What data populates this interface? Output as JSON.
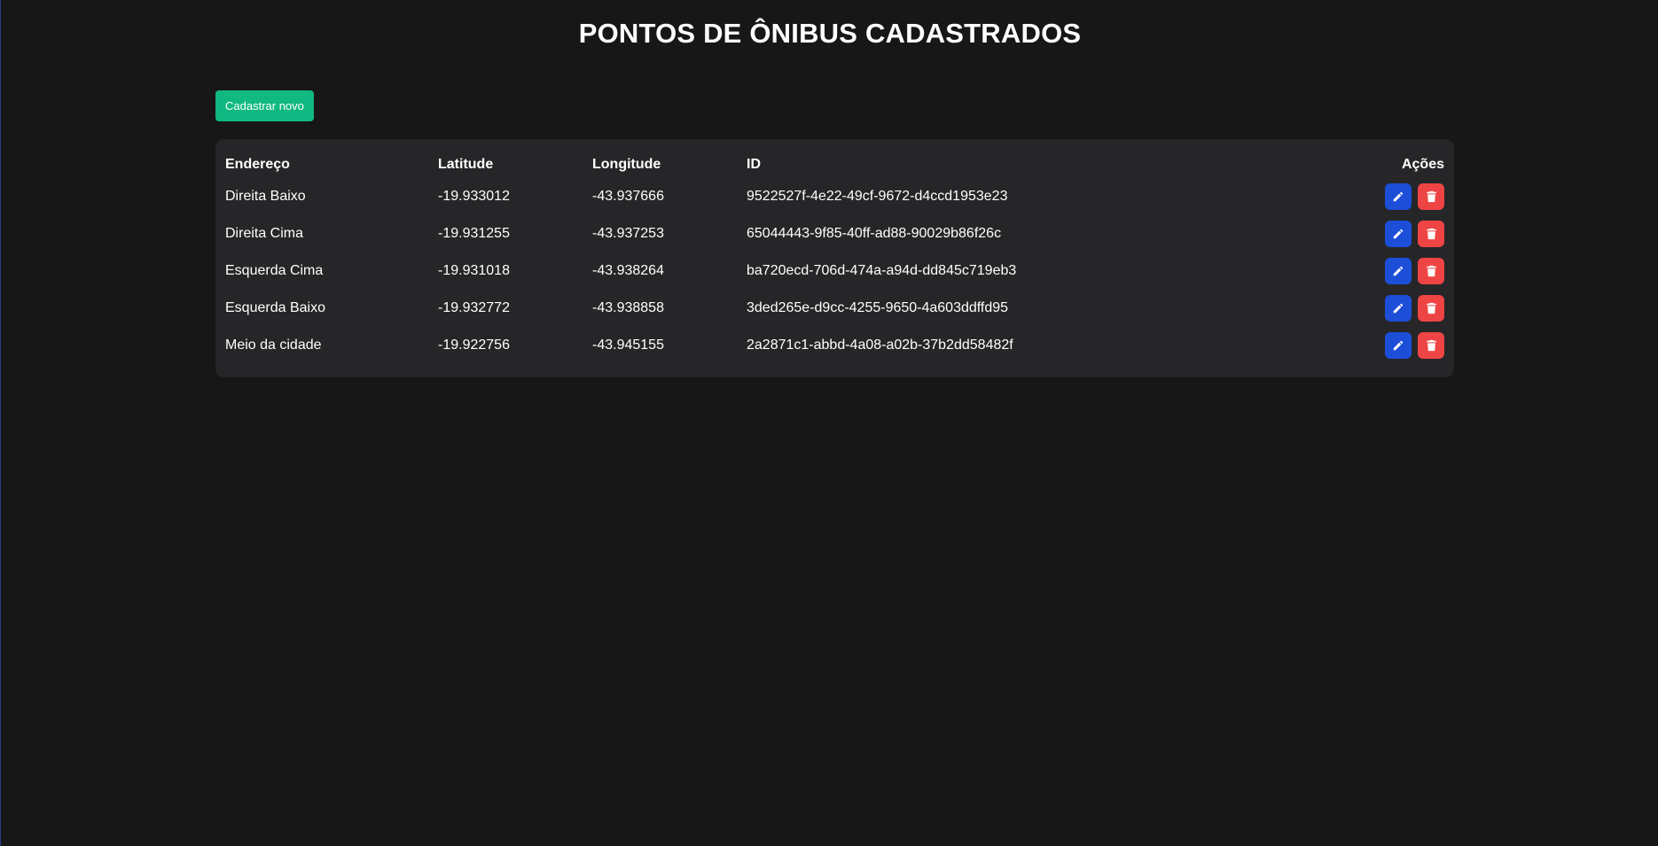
{
  "page": {
    "title": "PONTOS DE ÔNIBUS CADASTRADOS"
  },
  "toolbar": {
    "new_label": "Cadastrar novo"
  },
  "table": {
    "headers": {
      "address": "Endereço",
      "latitude": "Latitude",
      "longitude": "Longitude",
      "id": "ID",
      "actions": "Ações"
    },
    "rows": [
      {
        "address": "Direita Baixo",
        "latitude": "-19.933012",
        "longitude": "-43.937666",
        "id": "9522527f-4e22-49cf-9672-d4ccd1953e23"
      },
      {
        "address": "Direita Cima",
        "latitude": "-19.931255",
        "longitude": "-43.937253",
        "id": "65044443-9f85-40ff-ad88-90029b86f26c"
      },
      {
        "address": "Esquerda Cima",
        "latitude": "-19.931018",
        "longitude": "-43.938264",
        "id": "ba720ecd-706d-474a-a94d-dd845c719eb3"
      },
      {
        "address": "Esquerda Baixo",
        "latitude": "-19.932772",
        "longitude": "-43.938858",
        "id": "3ded265e-d9cc-4255-9650-4a603ddffd95"
      },
      {
        "address": "Meio da cidade",
        "latitude": "-19.922756",
        "longitude": "-43.945155",
        "id": "2a2871c1-abbd-4a08-a02b-37b2dd58482f"
      }
    ],
    "row_actions": {
      "edit_icon": "pencil-icon",
      "delete_icon": "trash-icon"
    }
  },
  "colors": {
    "background": "#171717",
    "card": "#262629",
    "new_button": "#10b981",
    "edit_button": "#1d4ed8",
    "delete_button": "#ef4444"
  }
}
